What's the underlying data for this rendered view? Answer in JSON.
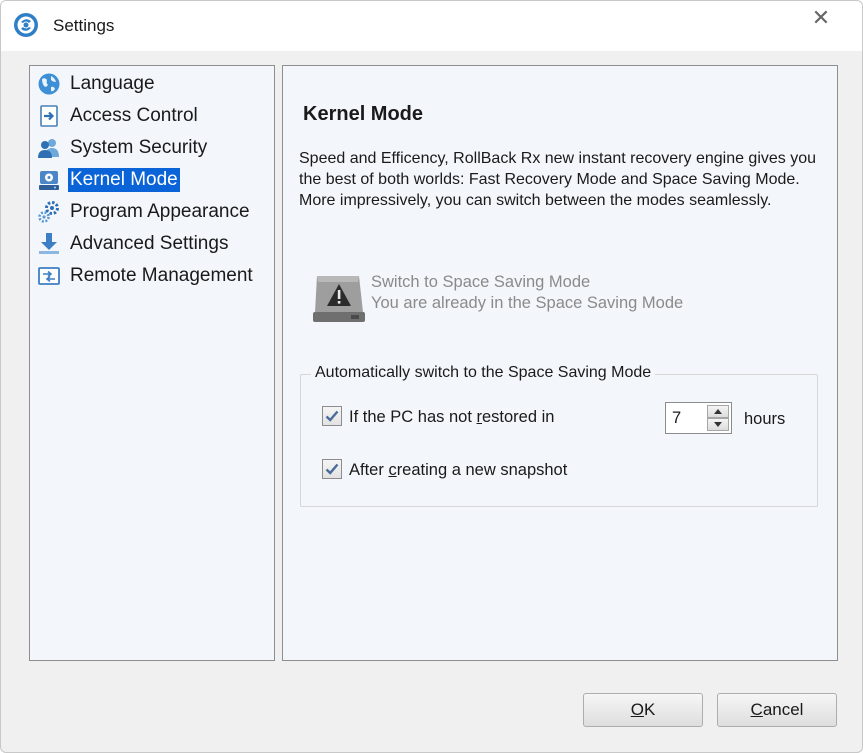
{
  "window": {
    "title": "Settings",
    "close_glyph": "✕"
  },
  "sidebar": {
    "items": [
      {
        "label": "Language",
        "icon": "globe-icon",
        "selected": false
      },
      {
        "label": "Access Control",
        "icon": "login-arrow-icon",
        "selected": false
      },
      {
        "label": "System Security",
        "icon": "users-icon",
        "selected": false
      },
      {
        "label": "Kernel Mode",
        "icon": "kernel-drive-icon",
        "selected": true
      },
      {
        "label": "Program Appearance",
        "icon": "gears-icon",
        "selected": false
      },
      {
        "label": "Advanced Settings",
        "icon": "download-arrow-icon",
        "selected": false
      },
      {
        "label": "Remote Management",
        "icon": "remote-console-icon",
        "selected": false
      }
    ]
  },
  "panel": {
    "title": "Kernel Mode",
    "description": "Speed and Efficency, RollBack Rx new instant recovery engine gives you the best of both worlds: Fast Recovery Mode and Space Saving Mode. More impressively, you can switch between the modes seamlessly.",
    "switch": {
      "title": "Switch to Space Saving Mode",
      "subtitle": "You are already in the Space Saving Mode",
      "icon": "warning-drive-icon"
    },
    "auto_switch": {
      "legend": "Automatically switch to the Space Saving Mode",
      "option1": {
        "label_before": "If the PC has not ",
        "label_underlined": "r",
        "label_after": "estored in",
        "checked": true
      },
      "hours_value": "7",
      "hours_label": "hours",
      "option2": {
        "label_before": "After ",
        "label_underlined": "c",
        "label_after": "reating a new snapshot",
        "checked": true
      }
    }
  },
  "buttons": {
    "ok": {
      "underlined": "O",
      "rest": "K"
    },
    "cancel": {
      "underlined": "C",
      "rest": "ancel"
    }
  },
  "colors": {
    "selection": "#0a64d8",
    "panel_bg": "#f3f7fb",
    "dialog_bg": "#f0f0f0",
    "disabled_text": "#8a8a8a"
  }
}
